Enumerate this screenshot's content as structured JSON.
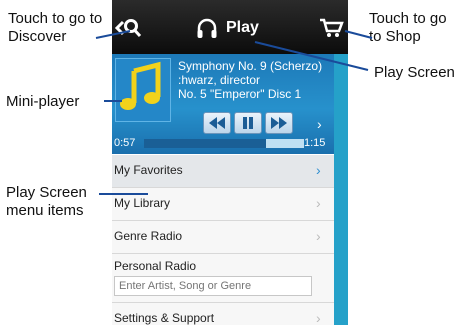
{
  "callouts": {
    "discover": "Touch to go to Discover",
    "shop": "Touch to go to Shop",
    "play_screen": "Play Screen",
    "mini_player": "Mini-player",
    "menu_items": "Play Screen menu items"
  },
  "header": {
    "title": "Play"
  },
  "mini_player": {
    "track_line_1": "Symphony No. 9 (Scherzo)",
    "track_line_2": ":hwarz, director",
    "track_line_3": "No. 5 \"Emperor\" Disc 1",
    "elapsed": "0:57",
    "total": "1:15",
    "progress": 0.76
  },
  "menu": {
    "items": [
      {
        "label": "My Favorites"
      },
      {
        "label": "My Library"
      },
      {
        "label": "Genre Radio"
      }
    ],
    "personal_radio": {
      "label": "Personal Radio",
      "placeholder": "Enter Artist, Song or Genre"
    },
    "settings": {
      "label": "Settings & Support"
    }
  },
  "colors": {
    "accent": "#1d79b8",
    "topbar": "#1a1a1a",
    "scrollbar": "#25a1c9"
  },
  "icons": [
    "search-icon",
    "headphones-icon",
    "cart-icon",
    "rewind-icon",
    "pause-icon",
    "fast-forward-icon",
    "chevron-right-icon"
  ]
}
